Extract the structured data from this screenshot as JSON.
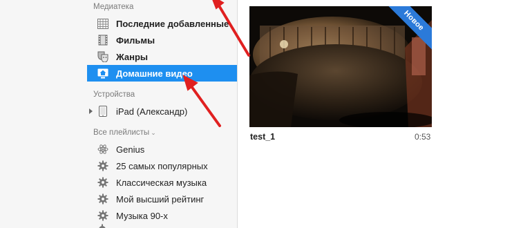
{
  "sidebar": {
    "library_header": "Медиатека",
    "library_items": [
      {
        "label": "Последние добавленные",
        "icon": "grid-icon"
      },
      {
        "label": "Фильмы",
        "icon": "film-icon"
      },
      {
        "label": "Жанры",
        "icon": "masks-icon"
      },
      {
        "label": "Домашние видео",
        "icon": "home-video-icon",
        "selected": true
      }
    ],
    "devices_header": "Устройства",
    "devices": [
      {
        "label": "iPad (Александр)",
        "icon": "ipad-icon"
      }
    ],
    "playlists_header": "Все плейлисты",
    "playlists_chevron": "⌄",
    "playlists": [
      {
        "label": "Genius",
        "icon": "genius-atom-icon"
      },
      {
        "label": "25 самых популярных",
        "icon": "gear-icon"
      },
      {
        "label": "Классическая музыка",
        "icon": "gear-icon"
      },
      {
        "label": "Мой высший рейтинг",
        "icon": "gear-icon"
      },
      {
        "label": "Музыка 90-х",
        "icon": "gear-icon"
      }
    ]
  },
  "main": {
    "video": {
      "title": "test_1",
      "duration": "0:53",
      "badge": "Новое"
    }
  },
  "colors": {
    "selection": "#1e8ff0",
    "badge": "#2b7ad9",
    "annotation": "#e02020"
  }
}
